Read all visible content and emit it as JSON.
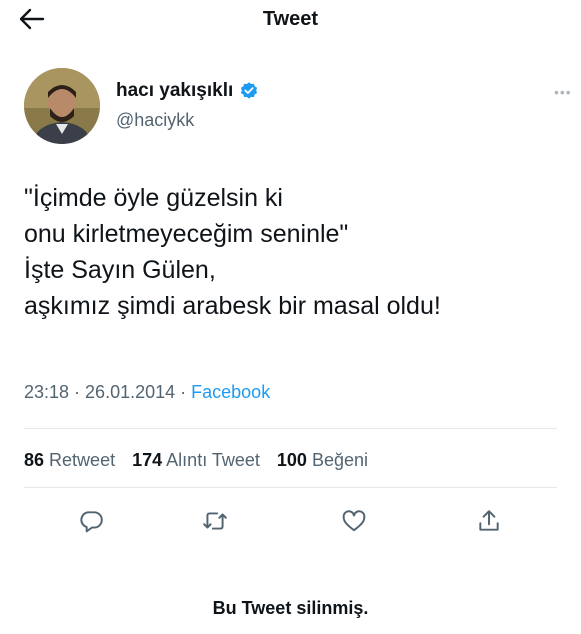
{
  "header": {
    "title": "Tweet",
    "back_icon": "arrow-left-icon"
  },
  "author": {
    "name": "hacı yakışıklı",
    "handle": "@haciykk",
    "verified_icon": "verified-badge-icon",
    "more_icon": "more-icon"
  },
  "tweet": {
    "lines": [
      "\"İçimde öyle güzelsin ki",
      "onu kirletmeyeceğim seninle\"",
      "İşte Sayın Gülen,",
      "aşkımız şimdi arabesk bir masal oldu!"
    ],
    "time": "23:18",
    "date": "26.01.2014",
    "separator": " · ",
    "source": "Facebook"
  },
  "stats": {
    "retweets_count": "86",
    "retweets_label": "Retweet",
    "quotes_count": "174",
    "quotes_label": "Alıntı Tweet",
    "likes_count": "100",
    "likes_label": "Beğeni"
  },
  "actions": [
    "reply-icon",
    "retweet-icon",
    "like-icon",
    "share-icon"
  ],
  "footer": {
    "deleted_text": "Bu Tweet silinmiş."
  },
  "colors": {
    "accent": "#1d9bf0",
    "muted": "#536471",
    "text": "#0f1419"
  }
}
